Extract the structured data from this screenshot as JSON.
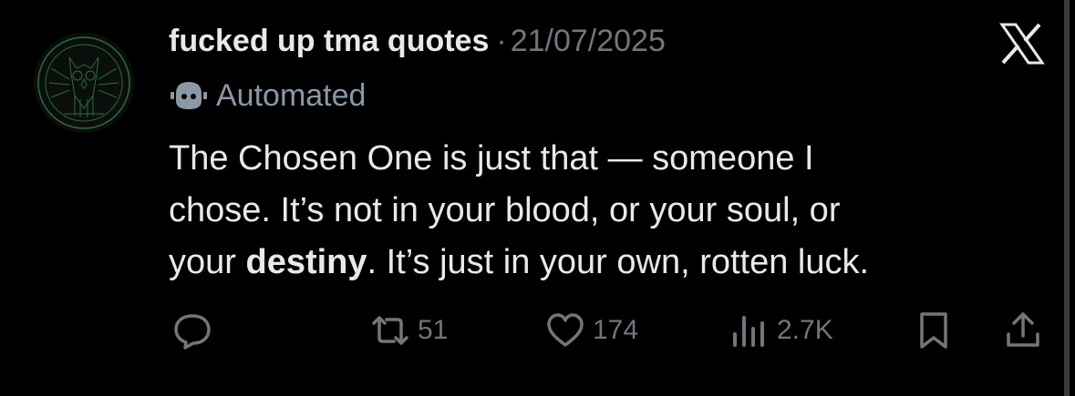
{
  "author": {
    "name": "fucked up tma quotes",
    "separator": "·",
    "date": "21/07/2025",
    "label": "Automated"
  },
  "body": {
    "line1": "The Chosen One is just that — someone I",
    "line2": "chose. It’s not in your blood, or your soul, or",
    "line3_pre": "your ",
    "line3_bold": "destiny",
    "line3_post": ". It’s just in your own, rotten luck."
  },
  "actions": {
    "reply": {
      "icon": "reply-icon"
    },
    "retweet": {
      "icon": "retweet-icon",
      "count": "51"
    },
    "like": {
      "icon": "heart-icon",
      "count": "174"
    },
    "views": {
      "icon": "views-icon",
      "count": "2.7K"
    },
    "bookmark": {
      "icon": "bookmark-icon"
    },
    "share": {
      "icon": "share-icon"
    }
  },
  "colors": {
    "background": "#000000",
    "text": "#e7e9ea",
    "muted": "#71767b",
    "avatar_accent": "#2f6b3d"
  }
}
